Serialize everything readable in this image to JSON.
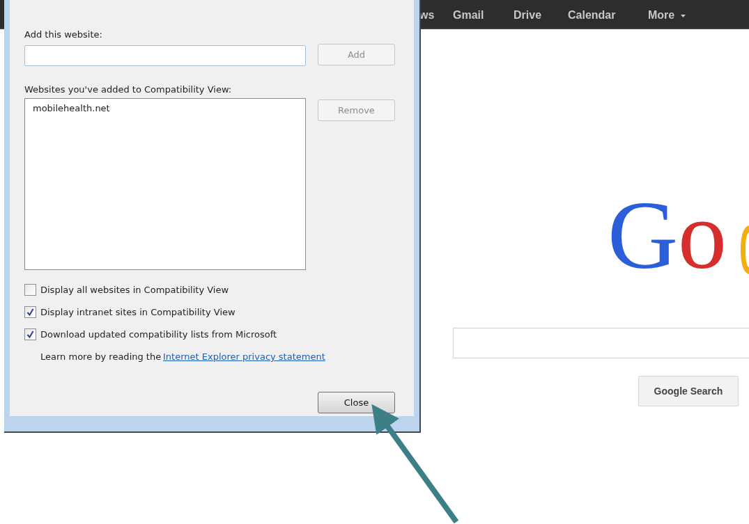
{
  "dialog": {
    "add_label": "Add this website:",
    "add_button": {
      "label": "Add",
      "disabled": true
    },
    "list_label": "Websites you've added to Compatibility View:",
    "sites": [
      {
        "text": "mobilehealth.net",
        "selected": false
      }
    ],
    "remove_button": {
      "label": "Remove",
      "disabled": true
    },
    "options": [
      {
        "label": "Display all websites in Compatibility View",
        "checked": false
      },
      {
        "label": "Display intranet sites in Compatibility View",
        "checked": true
      },
      {
        "label": "Download updated compatibility lists from Microsoft",
        "checked": true
      }
    ],
    "privacy_text": "Learn more by reading the",
    "privacy_link": "Internet Explorer privacy statement",
    "close_button": {
      "label": "Close",
      "disabled": false
    }
  },
  "browser": {
    "nav": [
      {
        "label": "ws",
        "caret": false
      },
      {
        "label": "Gmail",
        "caret": false
      },
      {
        "label": "Drive",
        "caret": false
      },
      {
        "label": "Calendar",
        "caret": false
      },
      {
        "label": "More",
        "caret": true
      }
    ],
    "logo": [
      {
        "text": "G",
        "color": "#2b5fd9"
      },
      {
        "text": "o",
        "color": "#d62d2d"
      }
    ],
    "search_button": "Google Search"
  }
}
